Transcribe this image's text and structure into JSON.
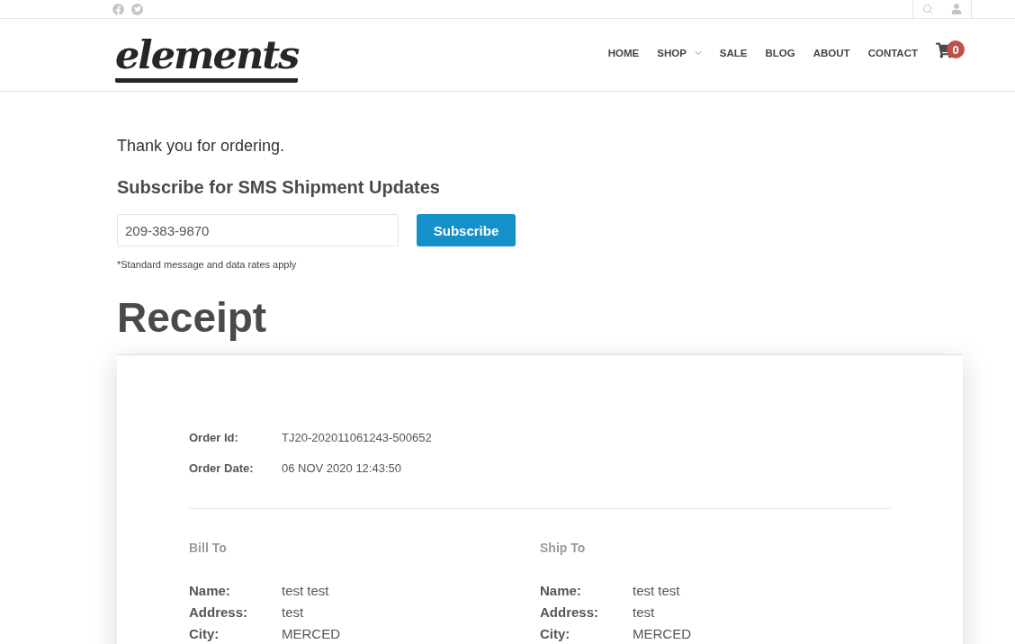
{
  "header": {
    "logo": "elements",
    "nav": [
      {
        "label": "HOME",
        "has_dropdown": false
      },
      {
        "label": "SHOP",
        "has_dropdown": true
      },
      {
        "label": "SALE",
        "has_dropdown": false
      },
      {
        "label": "BLOG",
        "has_dropdown": false
      },
      {
        "label": "ABOUT",
        "has_dropdown": false
      },
      {
        "label": "CONTACT",
        "has_dropdown": false
      }
    ],
    "cart_count": "0"
  },
  "message": "Thank you for ordering.",
  "sms_form": {
    "title": "Subscribe for SMS Shipment Updates",
    "phone": {
      "value": "209-383-9870"
    },
    "button": "Subscribe",
    "note": "*Standard message and data rates apply"
  },
  "receipt": {
    "title": "Receipt",
    "order_fields": [
      {
        "label": "Order Id:",
        "value": "TJ20-202011061243-500652"
      },
      {
        "label": "Order Date:",
        "value": "06 NOV 2020 12:43:50"
      }
    ],
    "addresses": [
      {
        "title": "Bill To",
        "fields": [
          {
            "label": "Name:",
            "value": "test test"
          },
          {
            "label": "Address:",
            "value": "test"
          },
          {
            "label": "City:",
            "value": "MERCED"
          }
        ]
      },
      {
        "title": "Ship To",
        "fields": [
          {
            "label": "Name:",
            "value": "test test"
          },
          {
            "label": "Address:",
            "value": "test"
          },
          {
            "label": "City:",
            "value": "MERCED"
          }
        ]
      }
    ]
  }
}
